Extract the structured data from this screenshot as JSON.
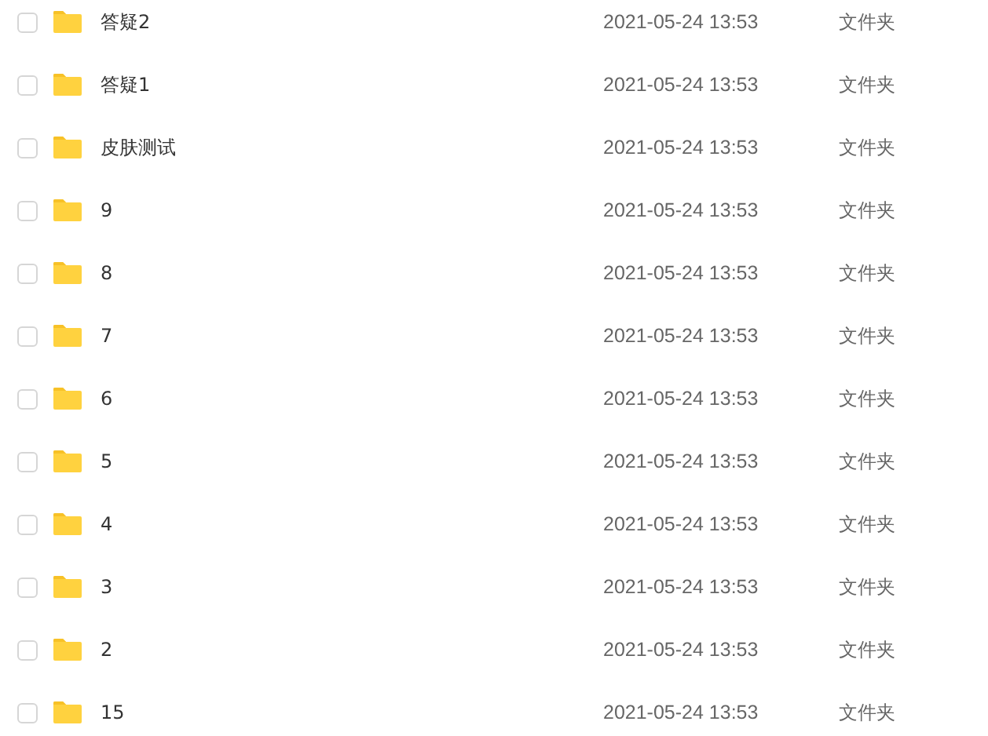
{
  "files": [
    {
      "name": "答疑2",
      "modified": "2021-05-24 13:53",
      "type": "文件夹",
      "checked": false
    },
    {
      "name": "答疑1",
      "modified": "2021-05-24 13:53",
      "type": "文件夹",
      "checked": false
    },
    {
      "name": "皮肤测试",
      "modified": "2021-05-24 13:53",
      "type": "文件夹",
      "checked": false
    },
    {
      "name": "9",
      "modified": "2021-05-24 13:53",
      "type": "文件夹",
      "checked": false
    },
    {
      "name": "8",
      "modified": "2021-05-24 13:53",
      "type": "文件夹",
      "checked": false
    },
    {
      "name": "7",
      "modified": "2021-05-24 13:53",
      "type": "文件夹",
      "checked": false
    },
    {
      "name": "6",
      "modified": "2021-05-24 13:53",
      "type": "文件夹",
      "checked": false
    },
    {
      "name": "5",
      "modified": "2021-05-24 13:53",
      "type": "文件夹",
      "checked": false
    },
    {
      "name": "4",
      "modified": "2021-05-24 13:53",
      "type": "文件夹",
      "checked": false
    },
    {
      "name": "3",
      "modified": "2021-05-24 13:53",
      "type": "文件夹",
      "checked": false
    },
    {
      "name": "2",
      "modified": "2021-05-24 13:53",
      "type": "文件夹",
      "checked": false
    },
    {
      "name": "15",
      "modified": "2021-05-24 13:53",
      "type": "文件夹",
      "checked": false
    }
  ]
}
